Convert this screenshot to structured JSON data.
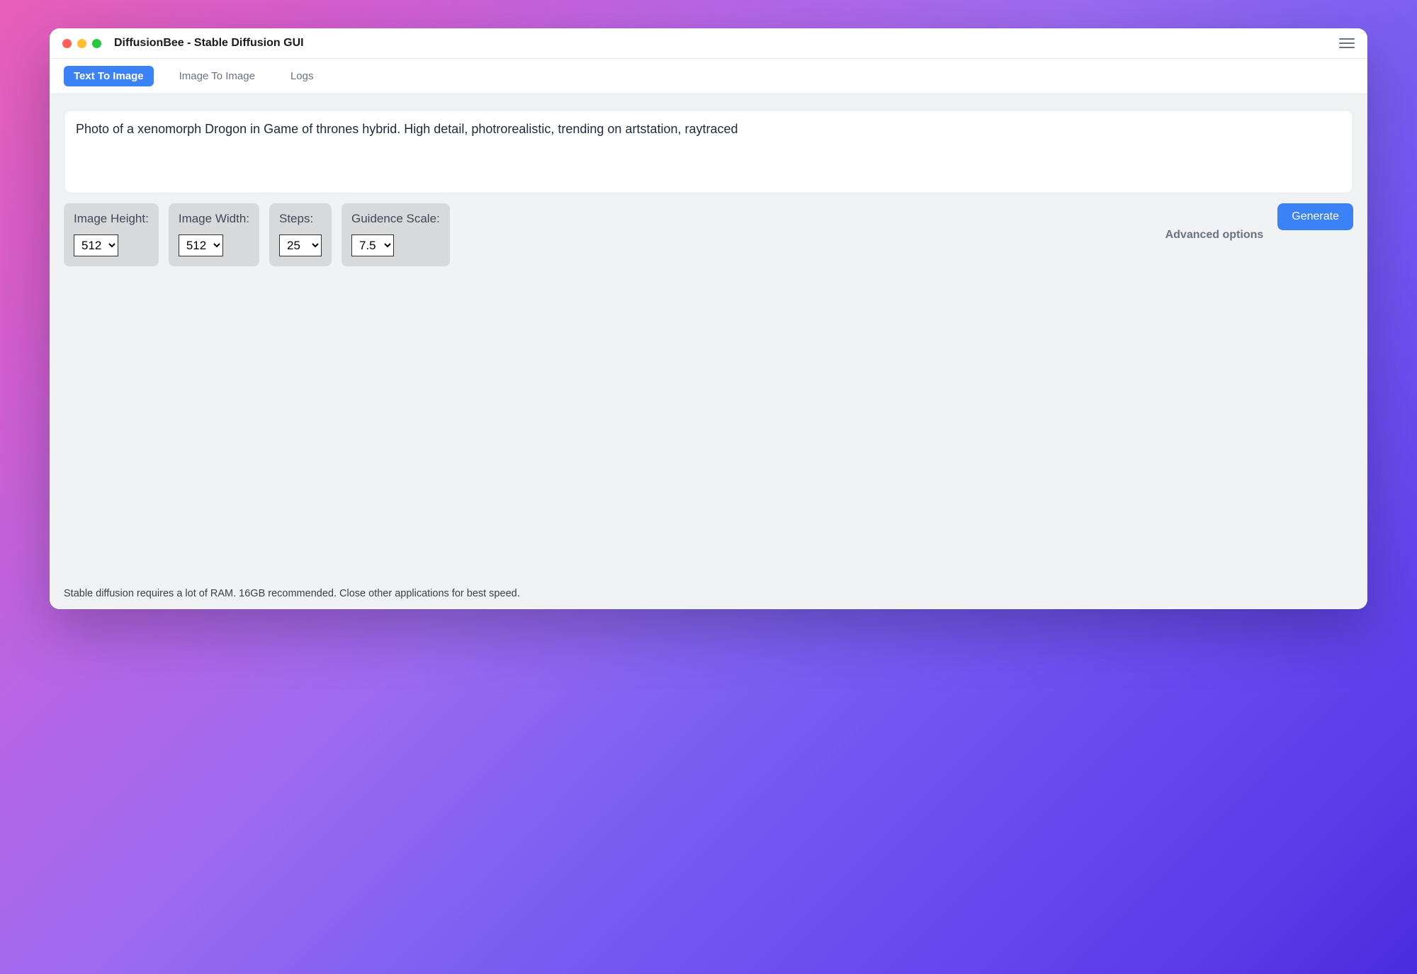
{
  "window": {
    "title": "DiffusionBee - Stable Diffusion GUI"
  },
  "tabs": [
    {
      "label": "Text To Image",
      "active": true
    },
    {
      "label": "Image To Image",
      "active": false
    },
    {
      "label": "Logs",
      "active": false
    }
  ],
  "prompt": {
    "value": "Photo of a xenomorph Drogon in Game of thrones hybrid. High detail, photrorealistic, trending on artstation, raytraced"
  },
  "options": {
    "image_height": {
      "label": "Image Height:",
      "value": "512"
    },
    "image_width": {
      "label": "Image Width:",
      "value": "512"
    },
    "steps": {
      "label": "Steps:",
      "value": "25"
    },
    "guidance": {
      "label": "Guidence Scale:",
      "value": "7.5"
    }
  },
  "actions": {
    "advanced_label": "Advanced options",
    "generate_label": "Generate"
  },
  "footer": {
    "note": "Stable diffusion requires a lot of RAM. 16GB recommended. Close other applications for best speed."
  }
}
